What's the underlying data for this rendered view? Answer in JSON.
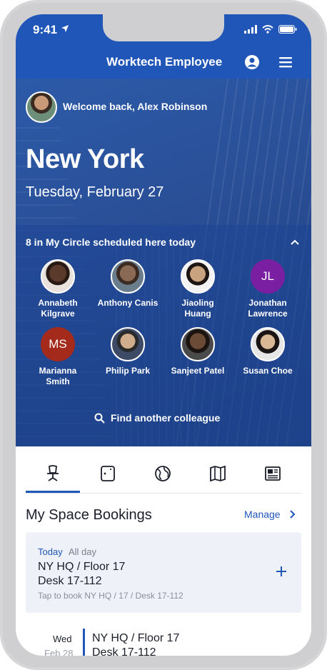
{
  "status": {
    "time": "9:41"
  },
  "app": {
    "title": "Worktech Employee"
  },
  "hero": {
    "welcome": "Welcome back, Alex Robinson",
    "city": "New York",
    "date": "Tuesday, February 27"
  },
  "circle": {
    "heading": "8 in My Circle scheduled here today",
    "people": [
      {
        "name": "Annabeth Kilgrave",
        "line1": "Annabeth",
        "line2": "Kilgrave",
        "type": "photo",
        "color": "#5a3a2a"
      },
      {
        "name": "Anthony Canis",
        "line1": "Anthony Canis",
        "line2": "",
        "type": "photo",
        "color": "#8a6a55"
      },
      {
        "name": "Jiaoling Huang",
        "line1": "Jiaoling",
        "line2": "Huang",
        "type": "photo",
        "color": "#c9a27f"
      },
      {
        "name": "Jonathan Lawrence",
        "line1": "Jonathan",
        "line2": "Lawrence",
        "type": "initials",
        "initials": "JL",
        "color": "#7b1fa2"
      },
      {
        "name": "Marianna Smith",
        "line1": "Marianna",
        "line2": "Smith",
        "type": "initials",
        "initials": "MS",
        "color": "#a42b1c"
      },
      {
        "name": "Philip Park",
        "line1": "Philip Park",
        "line2": "",
        "type": "photo",
        "color": "#d0ad8c"
      },
      {
        "name": "Sanjeet Patel",
        "line1": "Sanjeet Patel",
        "line2": "",
        "type": "photo",
        "color": "#6b4a36"
      },
      {
        "name": "Susan Choe",
        "line1": "Susan Choe",
        "line2": "",
        "type": "photo",
        "color": "#d9b896"
      }
    ],
    "find_label": "Find another colleague"
  },
  "tabs": [
    {
      "icon": "desk-chair-icon",
      "active": true
    },
    {
      "icon": "room-door-icon",
      "active": false
    },
    {
      "icon": "globe-icon",
      "active": false
    },
    {
      "icon": "map-icon",
      "active": false
    },
    {
      "icon": "news-icon",
      "active": false
    }
  ],
  "bookings": {
    "title": "My Space Bookings",
    "manage_label": "Manage",
    "today": {
      "day_label": "Today",
      "time_label": "All day",
      "location": "NY HQ / Floor 17",
      "desk": "Desk 17-112",
      "hint": "Tap to book NY HQ / 17 / Desk 17-112"
    },
    "next": {
      "weekday": "Wed",
      "date": "Feb 28",
      "location": "NY HQ / Floor 17",
      "desk": "Desk 17-112"
    }
  },
  "colors": {
    "brand": "#1f56b7",
    "hero": "#2a4f97",
    "card": "#eef1f7"
  }
}
